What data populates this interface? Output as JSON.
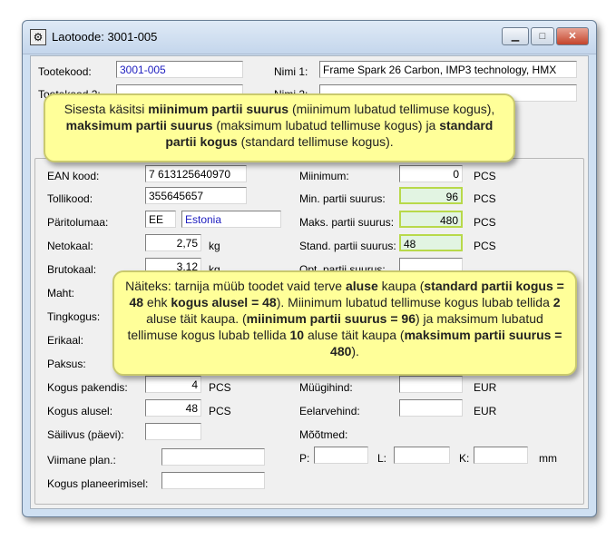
{
  "window": {
    "title": "Laotoode: 3001-005",
    "minimize": "▁",
    "maximize": "□",
    "close": "✕"
  },
  "header": {
    "tootekood_label": "Tootekood:",
    "tootekood_value": "3001-005",
    "nimi1_label": "Nimi 1:",
    "nimi1_value": "Frame Spark 26 Carbon, IMP3 technology, HMX",
    "tootekood2_label": "Tootekood 2:",
    "nimi2_label": "Nimi 2:"
  },
  "left": {
    "ean_label": "EAN kood:",
    "ean_value": "7 613125640970",
    "tollikood_label": "Tollikood:",
    "tollikood_value": "355645657",
    "paritolumaa_label": "Päritolumaa:",
    "country_code": "EE",
    "country_name": "Estonia",
    "netokaal_label": "Netokaal:",
    "netokaal_value": "2,75",
    "netokaal_unit": "kg",
    "brutokaal_label": "Brutokaal:",
    "brutokaal_value": "3,12",
    "brutokaal_unit": "kg",
    "maht_label": "Maht:",
    "tingkogus_label": "Tingkogus:",
    "erikaal_label": "Erikaal:",
    "paksus_label": "Paksus:",
    "kogus_pakendis_label": "Kogus pakendis:",
    "kogus_pakendis_value": "4",
    "kogus_pakendis_unit": "PCS",
    "kogus_alusel_label": "Kogus alusel:",
    "kogus_alusel_value": "48",
    "kogus_alusel_unit": "PCS",
    "sailivus_label": "Säilivus (päevi):",
    "viimane_plan_label": "Viimane plan.:",
    "kogus_planeerimisel_label": "Kogus planeerimisel:"
  },
  "right": {
    "min_label": "Miinimum:",
    "min_value": "0",
    "min_unit": "PCS",
    "min_partii_label": "Min. partii suurus:",
    "min_partii_value": "96",
    "min_partii_unit": "PCS",
    "maks_partii_label": "Maks. partii suurus:",
    "maks_partii_value": "480",
    "maks_partii_unit": "PCS",
    "stand_partii_label": "Stand. partii suurus:",
    "stand_partii_value": "48",
    "stand_partii_unit": "PCS",
    "opt_partii_label": "Opt. partii suurus:",
    "muugihind_label": "Müügihind:",
    "muugihind_unit": "EUR",
    "eelarvehind_label": "Eelarvehind:",
    "eelarvehind_unit": "EUR",
    "mootmed_label": "Mõõtmed:",
    "p_label": "P:",
    "l_label": "L:",
    "k_label": "K:",
    "mm_unit": "mm"
  },
  "callout1": {
    "t1": "Sisesta käsitsi ",
    "b1": "miinimum partii suurus",
    "t2": " (miinimum lubatud tellimuse kogus), ",
    "b2": "maksimum partii suurus",
    "t3": " (maksimum lubatud tellimuse kogus) ja ",
    "b3": "standard partii kogus",
    "t4": " (standard tellimuse kogus)."
  },
  "callout2": {
    "t1": "Näiteks: tarnija müüb toodet vaid terve ",
    "b1": "aluse",
    "t2": " kaupa (",
    "b2": "standard partii kogus = 48",
    "t3": " ehk ",
    "b3": "kogus alusel = 48",
    "t4": "). Miinimum lubatud tellimuse kogus lubab tellida ",
    "b4": "2",
    "t5": " aluse täit kaupa. (",
    "b5": "miinimum partii suurus = 96",
    "t6": ") ja maksimum lubatud tellimuse kogus lubab tellida ",
    "b6": "10",
    "t7": " aluse täit kaupa (",
    "b7": "maksimum partii suurus = 480",
    "t8": ")."
  }
}
